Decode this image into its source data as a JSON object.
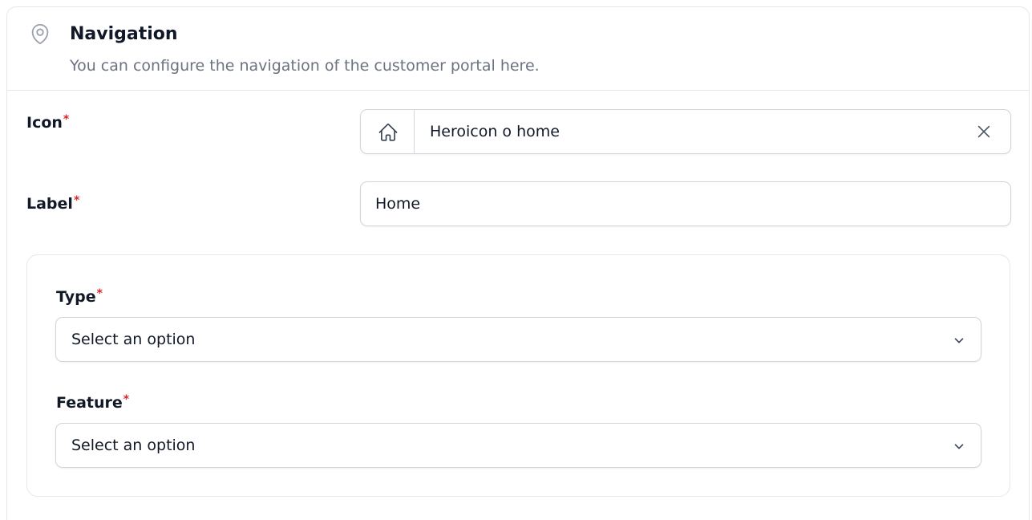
{
  "section": {
    "title": "Navigation",
    "description": "You can configure the navigation of the customer portal here.",
    "icon": "map-pin-icon"
  },
  "fields": {
    "icon": {
      "label": "Icon",
      "required_mark": "*",
      "value": "Heroicon o home",
      "prefix_icon": "home-icon",
      "clear_icon": "close-icon"
    },
    "label": {
      "label": "Label",
      "required_mark": "*",
      "value": "Home"
    },
    "type": {
      "label": "Type",
      "required_mark": "*",
      "value": "Select an option"
    },
    "feature": {
      "label": "Feature",
      "required_mark": "*",
      "value": "Select an option"
    }
  },
  "colors": {
    "required": "#dc2626",
    "muted_text": "#6b7280",
    "border": "#d1d5db"
  }
}
